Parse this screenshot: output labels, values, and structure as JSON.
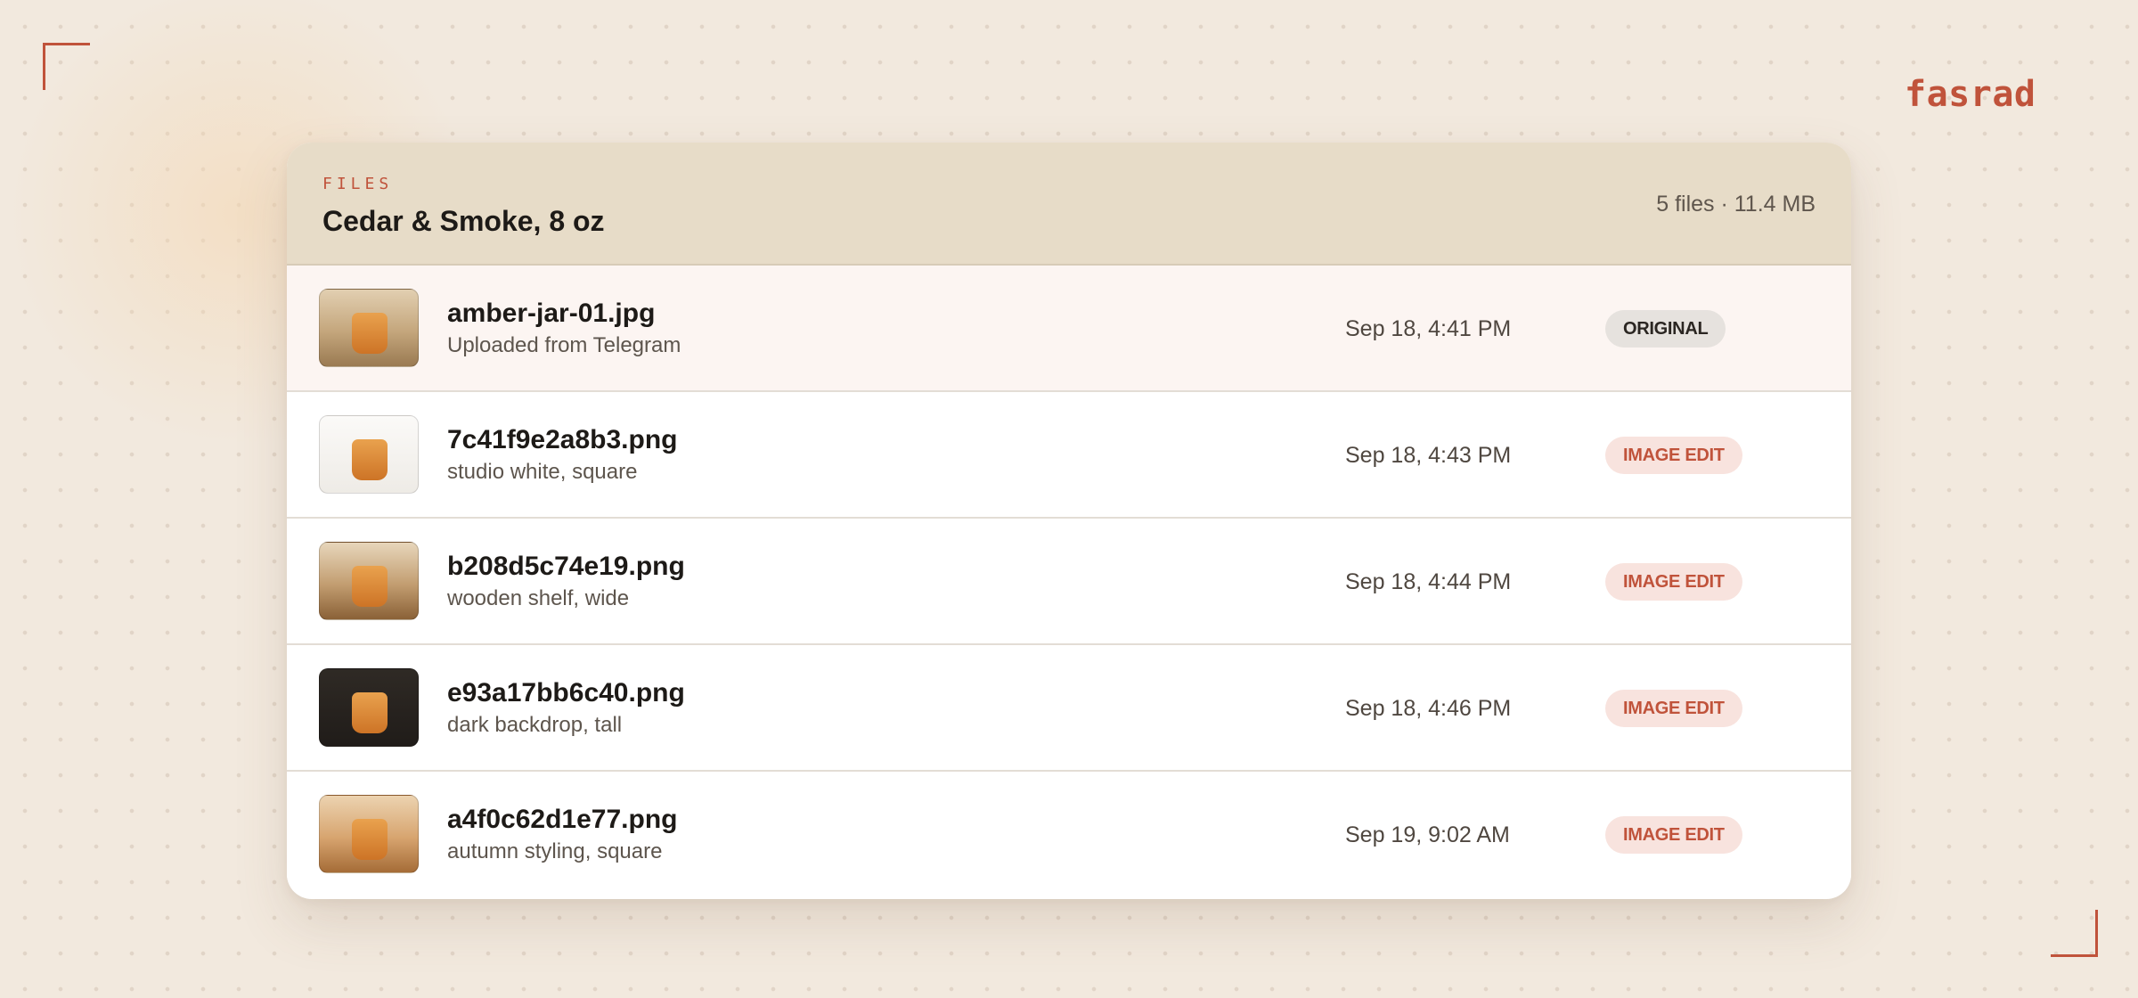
{
  "brand": {
    "name": "fasrad",
    "accent_color": "#c0533b"
  },
  "header": {
    "eyebrow": "FILES",
    "title": "Cedar & Smoke, 8 oz",
    "meta": "5 files · 11.4 MB"
  },
  "files": [
    {
      "name": "amber-jar-01.jpg",
      "description": "Uploaded from Telegram",
      "date": "Sep 18, 4:41 PM",
      "badge": "ORIGINAL",
      "thumbnail": "amber jar on beige backdrop",
      "selected": true
    },
    {
      "name": "7c41f9e2a8b3.png",
      "description": "studio white, square",
      "date": "Sep 18, 4:43 PM",
      "badge": "IMAGE EDIT",
      "thumbnail": "amber jar on white backdrop",
      "selected": false
    },
    {
      "name": "b208d5c74e19.png",
      "description": "wooden shelf, wide",
      "date": "Sep 18, 4:44 PM",
      "badge": "IMAGE EDIT",
      "thumbnail": "amber jar on wooden shelf",
      "selected": false
    },
    {
      "name": "e93a17bb6c40.png",
      "description": "dark backdrop, tall",
      "date": "Sep 18, 4:46 PM",
      "badge": "IMAGE EDIT",
      "thumbnail": "amber jar on dark backdrop",
      "selected": false
    },
    {
      "name": "a4f0c62d1e77.png",
      "description": "autumn styling, square",
      "date": "Sep 19, 9:02 AM",
      "badge": "IMAGE EDIT",
      "thumbnail": "amber jar with autumn styling",
      "selected": false
    }
  ]
}
